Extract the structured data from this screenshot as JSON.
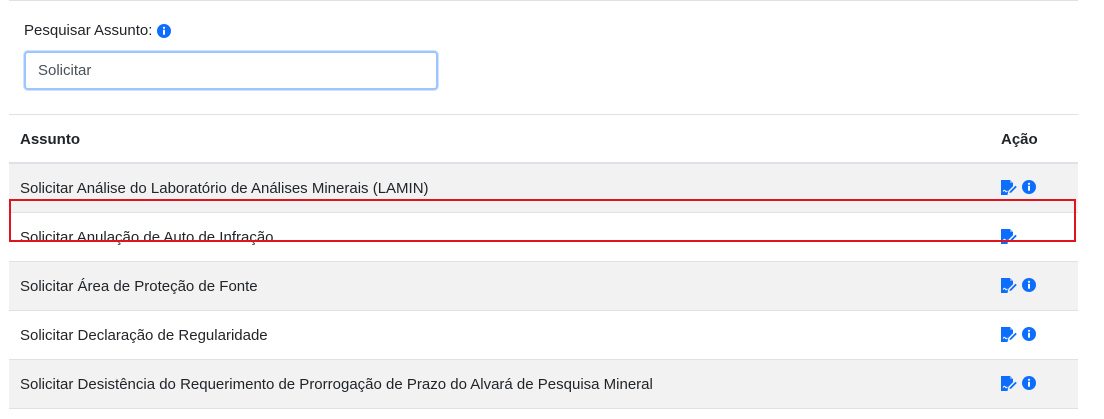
{
  "search": {
    "label": "Pesquisar Assunto:",
    "value": "Solicitar"
  },
  "table": {
    "headers": {
      "subject": "Assunto",
      "action": "Ação"
    },
    "rows": [
      {
        "subject": "Solicitar Análise do Laboratório de Análises Minerais (LAMIN)",
        "actions": [
          "edit-icon",
          "info-icon"
        ]
      },
      {
        "subject": "Solicitar Anulação de Auto de Infração",
        "actions": [
          "edit-icon"
        ]
      },
      {
        "subject": "Solicitar Área de Proteção de Fonte",
        "actions": [
          "edit-icon",
          "info-icon"
        ]
      },
      {
        "subject": "Solicitar Declaração de Regularidade",
        "actions": [
          "edit-icon",
          "info-icon"
        ],
        "highlighted": true
      },
      {
        "subject": "Solicitar Desistência do Requerimento de Prorrogação de Prazo do Alvará de Pesquisa Mineral",
        "actions": [
          "edit-icon",
          "info-icon"
        ]
      }
    ]
  },
  "colors": {
    "icon": "#0d6efd",
    "highlight": "#e0141e",
    "stripe": "#f2f2f2"
  }
}
